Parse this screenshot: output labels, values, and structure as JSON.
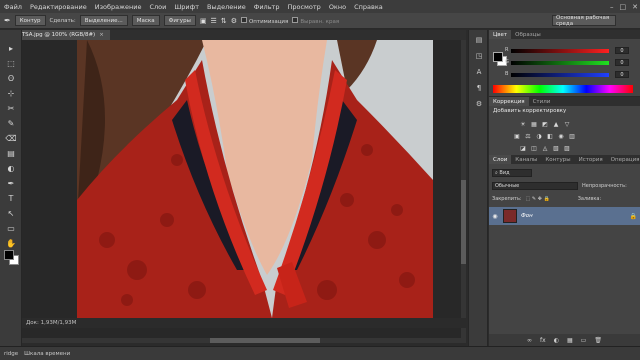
{
  "menu": [
    "Файл",
    "Редактирование",
    "Изображение",
    "Слои",
    "Шрифт",
    "Выделение",
    "Фильтр",
    "Просмотр",
    "Окно",
    "Справка"
  ],
  "window_controls": {
    "minimize": "–",
    "maximize": "□",
    "close": "✕"
  },
  "options_bar": {
    "mode": "Контур",
    "make_label": "Сделать:",
    "selection_btn": "Выделение...",
    "mask_btn": "Маска",
    "shape_btn": "Фигуры",
    "optimize_label": "Оптимизация",
    "align_edges_label": "Выравн. края",
    "workspace": "Основная рабочая среда"
  },
  "document": {
    "tab_title": "oyZmTSA.jpg @ 100% (RGB/8#)",
    "close": "×",
    "status": "Док: 1,93M/1,93M"
  },
  "tools": [
    "▸",
    "⬚",
    "ʘ",
    "⊹",
    "✂",
    "✎",
    "⌫",
    "▤",
    "◐",
    "✒",
    "T",
    "↖",
    "▭",
    "✋",
    "🔍"
  ],
  "right_strip_icons": [
    "▤",
    "◳",
    "A",
    "¶",
    "⚙"
  ],
  "color_panel": {
    "tabs": [
      "Цвет",
      "Образцы"
    ],
    "channels": [
      {
        "label": "R",
        "value": "0",
        "color": "#e03030"
      },
      {
        "label": "G",
        "value": "0",
        "color": "#30c030"
      },
      {
        "label": "B",
        "value": "0",
        "color": "#3050e0"
      }
    ]
  },
  "adjustments_panel": {
    "tabs": [
      "Коррекция",
      "Стили"
    ],
    "title": "Добавить корректировку",
    "row1": [
      "☀",
      "▦",
      "◩",
      "▲",
      "▽"
    ],
    "row2": [
      "▣",
      "⚖",
      "◑",
      "◧",
      "◉",
      "▥"
    ],
    "row3": [
      "◪",
      "◫",
      "◬",
      "▧",
      "▨"
    ]
  },
  "layers_panel": {
    "tabs": [
      "Слои",
      "Каналы",
      "Контуры",
      "История",
      "Операция"
    ],
    "kind": "Вид",
    "blend_mode": "Обычные",
    "opacity_label": "Непрозрачность:",
    "lock_label": "Закрепить:",
    "fill_label": "Заливка:",
    "layer_name": "Фон",
    "footer_icons": [
      "∞",
      "fx",
      "◐",
      "▦",
      "▭",
      "🗑"
    ]
  },
  "bottom_bar": {
    "tab1": "ridge",
    "tab2": "Шкала времени"
  }
}
